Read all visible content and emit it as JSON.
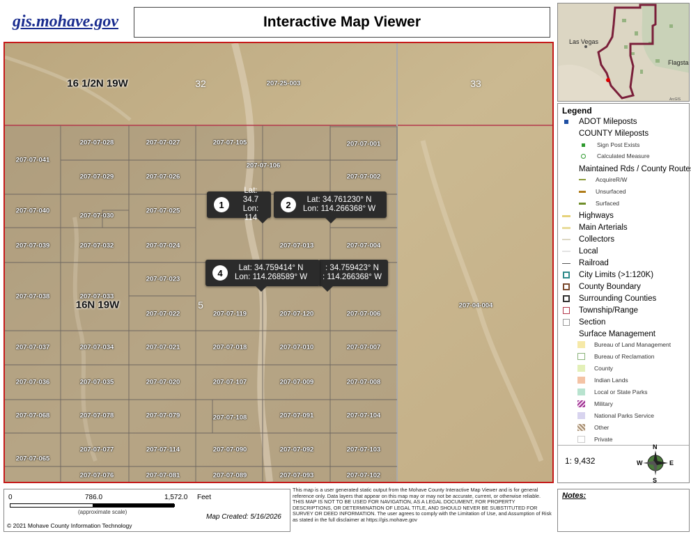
{
  "header": {
    "site_link": "gis.mohave.gov",
    "title": "Interactive Map Viewer"
  },
  "mini_map": {
    "labels": [
      "Las Vegas",
      "Flagsta"
    ],
    "credit": "ArcGIS"
  },
  "map": {
    "township_labels": [
      "16 1/2N 19W",
      "16N 19W"
    ],
    "section_labels": [
      "32",
      "33",
      "5"
    ],
    "parcels": [
      "207-25-003",
      "207-07-028",
      "207-07-027",
      "207-07-105",
      "207-07-001",
      "207-07-041",
      "207-07-106",
      "207-07-029",
      "207-07-026",
      "207-07-002",
      "207-07-040",
      "207-07-030",
      "207-07-025",
      "207-07-039",
      "207-07-032",
      "207-07-024",
      "207-07-013",
      "207-07-004",
      "207-07-023",
      "207-07-038",
      "207-07-033",
      "207-07-022",
      "207-07-119",
      "207-07-120",
      "207-07-006",
      "207-04-004",
      "207-07-037",
      "207-07-034",
      "207-07-021",
      "207-07-018",
      "207-07-010",
      "207-07-007",
      "207-07-036",
      "207-07-035",
      "207-07-020",
      "207-07-107",
      "207-07-009",
      "207-07-008",
      "207-07-068",
      "207-07-078",
      "207-07-079",
      "207-07-108",
      "207-07-091",
      "207-07-104",
      "207-07-065",
      "207-07-077",
      "207-07-114",
      "207-07-090",
      "207-07-092",
      "207-07-103",
      "207-07-076",
      "207-07-081",
      "207-07-089",
      "207-07-093",
      "207-07-102"
    ],
    "callouts": [
      {
        "num": "1",
        "lat": "Lat: 34.7",
        "lon": "Lon: 114"
      },
      {
        "num": "2",
        "lat": "Lat: 34.761230° N",
        "lon": "Lon: 114.266368° W"
      },
      {
        "num": "4",
        "lat": "Lat: 34.759414° N",
        "lon": "Lon: 114.268589° W"
      },
      {
        "num": "3",
        "lat": ": 34.759423° N",
        "lon": ": 114.266368° W"
      }
    ],
    "colors": {
      "border": "#c51a1a",
      "township_line": "#b3364a",
      "callout_bg": "#2b2b2b"
    }
  },
  "legend": {
    "title": "Legend",
    "adot": "ADOT Mileposts",
    "county_mileposts": "COUNTY Mileposts",
    "sign_post": "Sign Post Exists",
    "calc_measure": "Calculated Measure",
    "maintained": "Maintained Rds / County Routes",
    "acquire_rw": "AcquireR/W",
    "unsurfaced": "Unsurfaced",
    "surfaced": "Surfaced",
    "highways": "Highways",
    "main_arterials": "Main Arterials",
    "collectors": "Collectors",
    "local": "Local",
    "railroad": "Railroad",
    "city_limits": "City Limits (>1:120K)",
    "county_boundary": "County Boundary",
    "surrounding_counties": "Surrounding Counties",
    "township_range": "Township/Range",
    "section": "Section",
    "surface_mgmt": "Surface Management",
    "blm": "Bureau of Land Management",
    "reclamation": "Bureau of Reclamation",
    "county": "County",
    "indian_lands": "Indian Lands",
    "state_parks": "Local or State Parks",
    "military": "Military",
    "national_parks": "National Parks Service",
    "other": "Other",
    "private": "Private",
    "scale": "1: 9,432",
    "compass": {
      "n": "N",
      "s": "S",
      "e": "E",
      "w": "W"
    }
  },
  "footer": {
    "scale_zero": "0",
    "scale_mid": "786.0",
    "scale_end": "1,572.0",
    "scale_unit": "Feet",
    "approx_scale": "(approximate scale)",
    "map_created": "Map Created: 5/16/2026",
    "copyright": "© 2021 Mohave County Information Technology",
    "disclaimer": "This map is a user generated static output from the Mohave County Interactive Map Viewer and is for general reference only. Data layers that appear on this map may or may not be accurate, current, or otherwise reliable. THIS MAP IS NOT TO BE USED FOR NAVIGATION, AS A LEGAL DOCUMENT, FOR PROPERTY DESCRIPTIONS, OR DETERMINATION OF LEGAL TITLE, AND SHOULD NEVER BE SUBSTITUTED FOR SURVEY OR DEED INFORMATION. The user agrees to comply with the Limitation of Use, and Assumption of Risk as stated in the full disclaimer at https://gis.mohave.gov",
    "notes_label": "Notes:"
  }
}
